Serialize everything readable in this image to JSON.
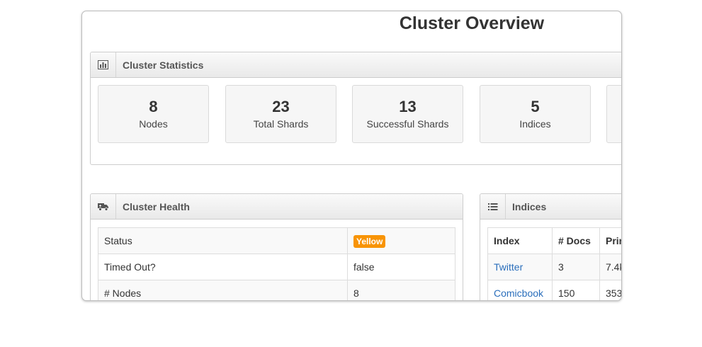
{
  "page": {
    "title": "Cluster Overview"
  },
  "cluster_statistics": {
    "title": "Cluster Statistics",
    "icon": "bar-chart-icon",
    "stats": [
      {
        "value": "8",
        "label": "Nodes"
      },
      {
        "value": "23",
        "label": "Total Shards"
      },
      {
        "value": "13",
        "label": "Successful Shards"
      },
      {
        "value": "5",
        "label": "Indices"
      }
    ]
  },
  "cluster_health": {
    "title": "Cluster Health",
    "icon": "truck-icon",
    "rows": [
      {
        "label": "Status",
        "value": "Yellow",
        "badge_color": "#f89406"
      },
      {
        "label": "Timed Out?",
        "value": "false"
      },
      {
        "label": "# Nodes",
        "value": "8"
      }
    ]
  },
  "indices": {
    "title": "Indices",
    "icon": "list-icon",
    "headers": [
      "Index",
      "# Docs",
      "Prir"
    ],
    "rows": [
      {
        "index": "Twitter",
        "docs": "3",
        "primary": "7.4k"
      },
      {
        "index": "Comicbook",
        "docs": "150",
        "primary": "353"
      }
    ]
  }
}
